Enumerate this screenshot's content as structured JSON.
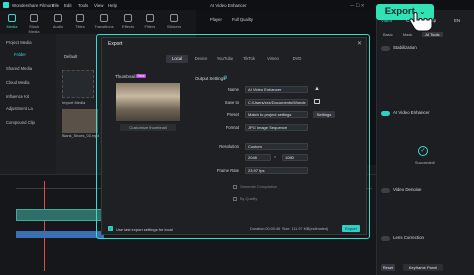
{
  "app": {
    "name": "Wondershare Filmora",
    "menus": [
      "File",
      "Edit",
      "Tools",
      "View",
      "Help"
    ],
    "project_title": "AI Video Enhancer"
  },
  "toolbar": {
    "items": [
      "Media",
      "Stock Media",
      "Audio",
      "Titles",
      "Transitions",
      "Effects",
      "Filters",
      "Stickers"
    ]
  },
  "left_nav": {
    "items": [
      "Project Media",
      "Folder",
      "Shared Media",
      "Cloud Media",
      "Influence Kit",
      "Adjustment La",
      "Compound Clip"
    ]
  },
  "media": {
    "default_label": "Default",
    "import_label": "Import Media",
    "clip_name": "Blank_Shoes_03.mp4"
  },
  "player": {
    "label": "Player",
    "quality": "Full Quality"
  },
  "right_panel": {
    "tabs": [
      "Video",
      "Color",
      "Sp"
    ],
    "subtabs": [
      "Basic",
      "Mask",
      "AI Tools"
    ],
    "stabilization": "Stabilization",
    "ai_enhancer": "AI Video Enhancer",
    "succeeded": "Succeeded!",
    "denoise": "Video Denoise",
    "lens": "Lens Correction",
    "reset": "Reset",
    "keyframe": "Keyframe Panel"
  },
  "export_button": {
    "label": "Export",
    "extra": "EN"
  },
  "dialog": {
    "title": "Export",
    "tabs": [
      "Local",
      "Device",
      "YouTube",
      "TikTok",
      "Vimeo",
      "DVD"
    ],
    "thumbnail_label": "Thumbnail",
    "thumbnail_badge": "Beta",
    "customize_thumbnail": "Customize thumbnail",
    "output_settings": "Output Settings",
    "fields": {
      "name_label": "Name",
      "name_value": "AI Video Enhancer",
      "save_label": "Save to",
      "save_value": "C:/Users/xxx/Documents/Wonde",
      "preset_label": "Preset",
      "preset_value": "Match to project settings",
      "settings_btn": "Settings",
      "format_label": "Format",
      "format_value": "JPG Image Sequence",
      "resolution_label": "Resolution",
      "resolution_value": "Custom",
      "width": "2048",
      "height": "1080",
      "framerate_label": "Frame Rate",
      "framerate_value": "23.97 fps",
      "option1": "Generate Compilation",
      "option2": "By Quality"
    },
    "footer": {
      "checkbox_label": "Use last export settings for local",
      "duration": "Duration:00:00:46",
      "size": "Size: 111.97 MB(estimated)",
      "export": "Export"
    }
  },
  "colors": {
    "accent": "#2fe0cf",
    "export_green": "#31e2b4",
    "bg": "#17191d",
    "clip_video": "#2f6f6a",
    "clip_audio": "#3c6fb0"
  }
}
